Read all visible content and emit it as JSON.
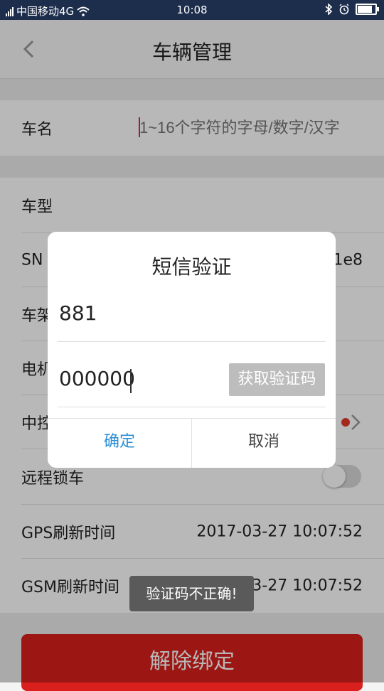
{
  "status_bar": {
    "carrier": "中国移动4G",
    "time": "10:08",
    "battery_level": 0.9
  },
  "header": {
    "title": "车辆管理",
    "back_icon": "chevron-left-icon"
  },
  "form": {
    "car_name_label": "车名",
    "car_name_placeholder": "1~16个字符的字母/数字/汉字",
    "car_type_label": "车型",
    "sn_label": "SN",
    "sn_value_visible": "1e8",
    "frame_label_visible": "车架",
    "motor_label_visible": "电机",
    "controller_label_visible": "中控",
    "remote_lock_label": "远程锁车",
    "remote_lock_on": false,
    "gps_label": "GPS刷新时间",
    "gps_value": "2017-03-27 10:07:52",
    "gsm_label": "GSM刷新时间",
    "gsm_value": "2017-03-27 10:07:52"
  },
  "unbind_button": "解除绑定",
  "dialog": {
    "title": "短信验证",
    "phone_value": "881",
    "code_value": "000000",
    "get_code_label": "获取验证码",
    "confirm_label": "确定",
    "cancel_label": "取消"
  },
  "toast": "验证码不正确!",
  "colors": {
    "status_bar": "#1d2d4c",
    "accent_red": "#d9201d",
    "link_blue": "#2c8fd6",
    "dot_red": "#e23a2b"
  }
}
